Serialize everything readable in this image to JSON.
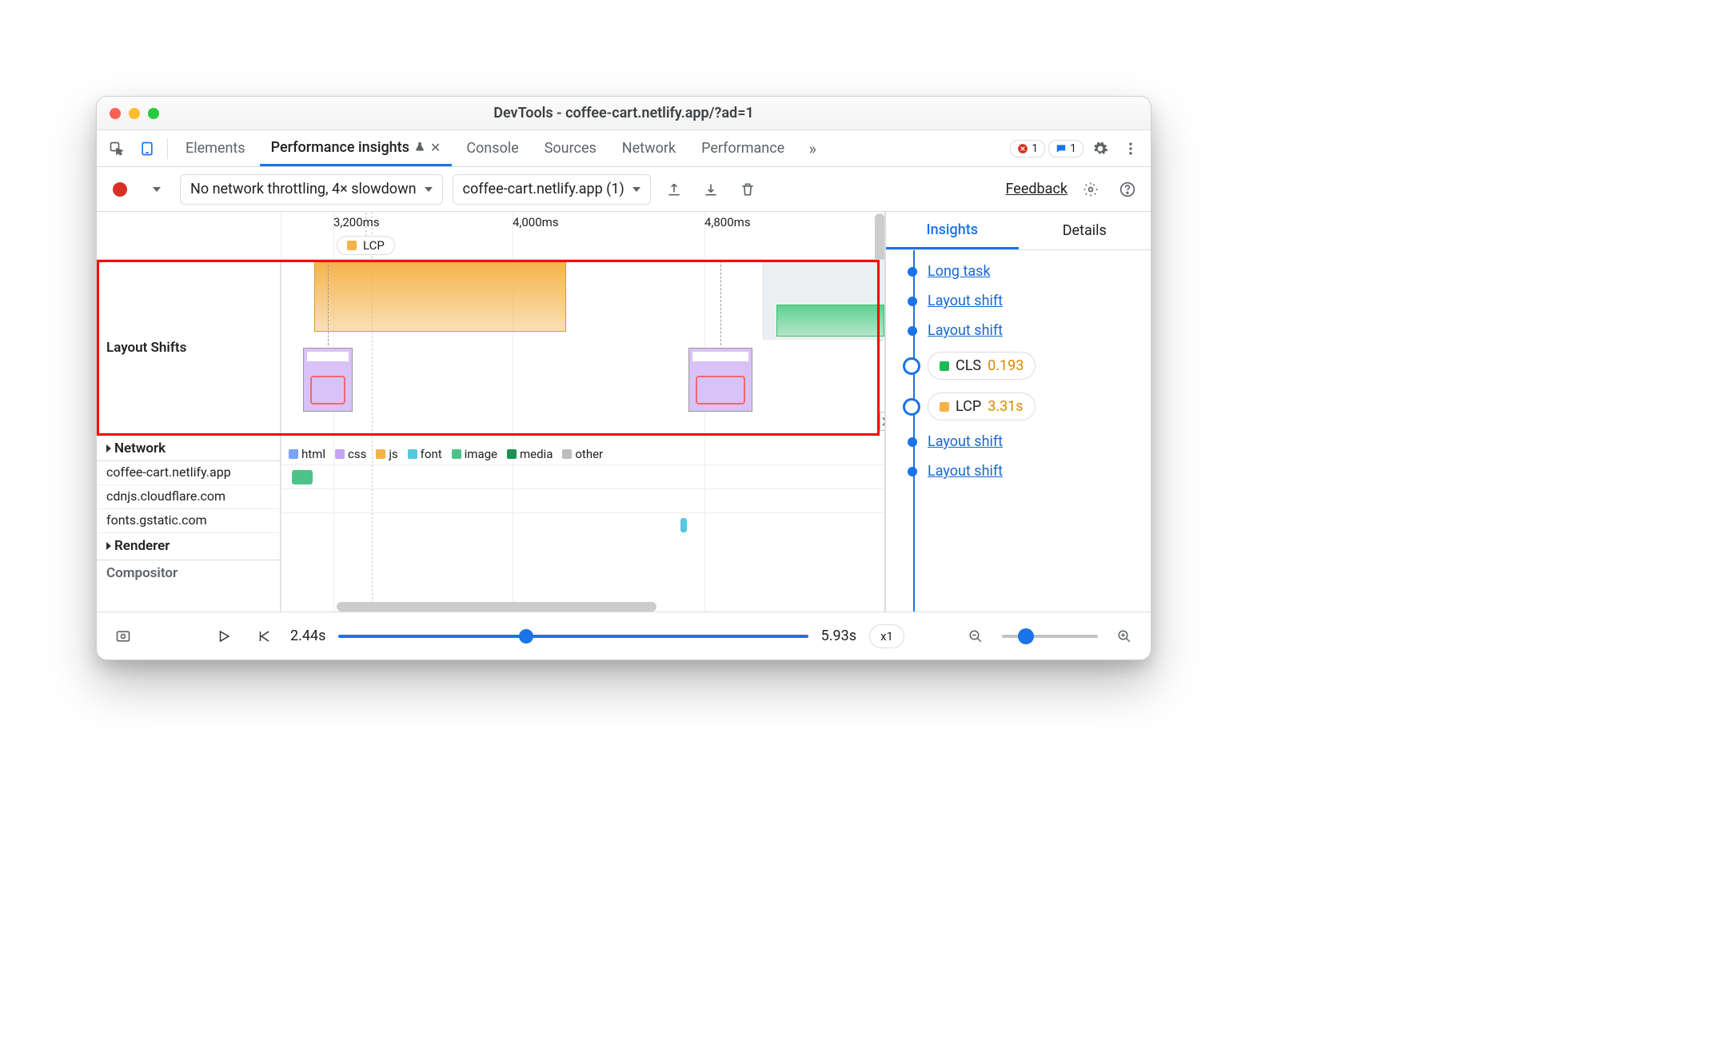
{
  "window_title": "DevTools - coffee-cart.netlify.app/?ad=1",
  "tabs": {
    "elements": "Elements",
    "perf_insights": "Performance insights",
    "console": "Console",
    "sources": "Sources",
    "network": "Network",
    "performance": "Performance"
  },
  "error_count": "1",
  "message_count": "1",
  "toolbar": {
    "throttle": "No network throttling, 4× slowdown",
    "recording_select": "coffee-cart.netlify.app (1)",
    "feedback": "Feedback"
  },
  "ruler": {
    "ticks": [
      "3,200ms",
      "4,000ms",
      "4,800ms"
    ],
    "lcp_chip": "LCP"
  },
  "lanes": {
    "layout_shifts": "Layout Shifts",
    "network": "Network",
    "renderer": "Renderer",
    "compositor": "Compositor"
  },
  "legend": {
    "html": "html",
    "css": "css",
    "js": "js",
    "font": "font",
    "image": "image",
    "media": "media",
    "other": "other"
  },
  "hosts": [
    "coffee-cart.netlify.app",
    "cdnjs.cloudflare.com",
    "fonts.gstatic.com"
  ],
  "sidebar": {
    "tabs": {
      "insights": "Insights",
      "details": "Details"
    },
    "items": {
      "long_task": "Long task",
      "layout_shift": "Layout shift",
      "cls_label": "CLS",
      "cls_value": "0.193",
      "lcp_label": "LCP",
      "lcp_value": "3.31s"
    }
  },
  "footer": {
    "start": "2.44s",
    "end": "5.93s",
    "speed": "x1"
  }
}
